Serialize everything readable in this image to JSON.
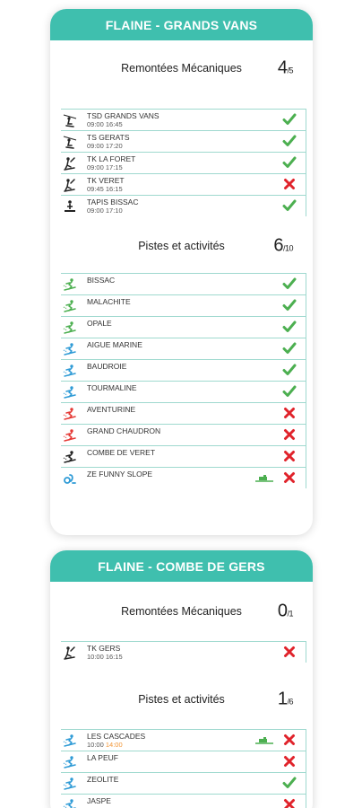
{
  "sectors": [
    {
      "title": "FLAINE - GRANDS VANS",
      "lifts": {
        "label": "Remontées Mécaniques",
        "open": "4",
        "total": "/5",
        "items": [
          {
            "name": "TSD GRANDS VANS",
            "hours": "09:00 16:45",
            "type": "chairlift-icon",
            "status": "open"
          },
          {
            "name": "TS GERATS",
            "hours": "09:00 17:20",
            "type": "chairlift-icon",
            "status": "open"
          },
          {
            "name": "TK LA FORET",
            "hours": "09:00 17:15",
            "type": "skilift-icon",
            "status": "open"
          },
          {
            "name": "TK VERET",
            "hours": "09:45 16:15",
            "type": "skilift-icon",
            "status": "closed"
          },
          {
            "name": "TAPIS BISSAC",
            "hours": "09:00 17:10",
            "type": "carpet-lift-icon",
            "status": "open"
          }
        ]
      },
      "slopes": {
        "label": "Pistes et activités",
        "open": "6",
        "total": "/10",
        "items": [
          {
            "name": "BISSAC",
            "color": "#4caf50",
            "status": "open"
          },
          {
            "name": "MALACHITE",
            "color": "#4caf50",
            "status": "open"
          },
          {
            "name": "OPALE",
            "color": "#4caf50",
            "status": "open"
          },
          {
            "name": "AIGUE MARINE",
            "color": "#2f9bd6",
            "status": "open"
          },
          {
            "name": "BAUDROIE",
            "color": "#2f9bd6",
            "status": "open"
          },
          {
            "name": "TOURMALINE",
            "color": "#2f9bd6",
            "status": "open"
          },
          {
            "name": "AVENTURINE",
            "color": "#e53935",
            "status": "closed"
          },
          {
            "name": "GRAND CHAUDRON",
            "color": "#e53935",
            "status": "closed"
          },
          {
            "name": "COMBE DE VERET",
            "color": "#222222",
            "status": "closed"
          },
          {
            "name": "ZE FUNNY SLOPE",
            "color": "#2f9bd6",
            "status": "closed",
            "groomed": true,
            "kind": "funslope"
          }
        ]
      }
    },
    {
      "title": "FLAINE - COMBE DE GERS",
      "lifts": {
        "label": "Remontées Mécaniques",
        "open": "0",
        "total": "/1",
        "items": [
          {
            "name": "TK GERS",
            "hours": "10:00 16:15",
            "type": "skilift-icon",
            "status": "closed"
          }
        ]
      },
      "slopes": {
        "label": "Pistes et activités",
        "open": "1",
        "total": "/6",
        "items": [
          {
            "name": "LES CASCADES",
            "hours_open": "10:00",
            "hours_close": "14:00",
            "color": "#2f9bd6",
            "status": "closed",
            "groomed": true
          },
          {
            "name": "LA PEUF",
            "color": "#2f9bd6",
            "status": "closed"
          },
          {
            "name": "ZEOLITE",
            "color": "#2f9bd6",
            "status": "open"
          },
          {
            "name": "JASPE",
            "color": "#2f9bd6",
            "status": "closed"
          }
        ]
      }
    }
  ],
  "colors": {
    "header": "#3fbfae",
    "open": "#4caf50",
    "closed": "#e0232b",
    "row_border": "#9fd9cf",
    "late_hour": "#f29534"
  }
}
